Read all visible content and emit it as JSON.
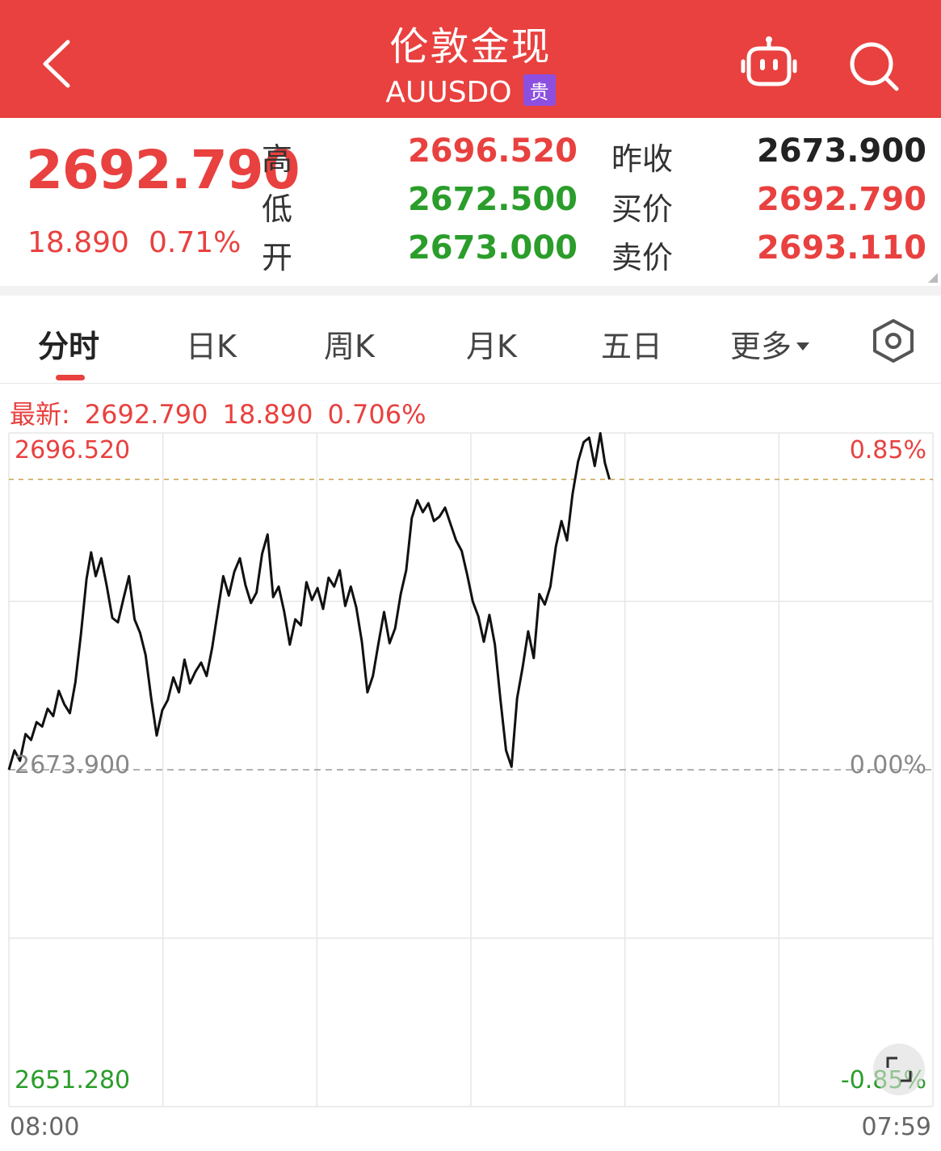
{
  "header": {
    "title": "伦敦金现",
    "code": "AUUSDO",
    "badge": "贵",
    "accent": "#e8413f"
  },
  "quote": {
    "last": "2692.790",
    "change": "18.890",
    "change_pct": "0.71%",
    "high_label": "高",
    "high": "2696.520",
    "low_label": "低",
    "low": "2672.500",
    "open_label": "开",
    "open": "2673.000",
    "prev_close_label": "昨收",
    "prev_close": "2673.900",
    "bid_label": "买价",
    "bid": "2692.790",
    "ask_label": "卖价",
    "ask": "2693.110"
  },
  "tabs": [
    {
      "label": "分时",
      "active": true
    },
    {
      "label": "日K"
    },
    {
      "label": "周K"
    },
    {
      "label": "月K"
    },
    {
      "label": "五日"
    },
    {
      "label": "更多"
    }
  ],
  "latest_line": {
    "label": "最新:",
    "price": "2692.790",
    "change": "18.890",
    "pct": "0.706%"
  },
  "chart_data": {
    "type": "line",
    "y_top_label": "2696.520",
    "y_mid_label": "2673.900",
    "y_bottom_label": "2651.280",
    "pct_top_label": "0.85%",
    "pct_mid_label": "0.00%",
    "pct_bottom_label": "-0.85%",
    "x_start_label": "08:00",
    "x_end_label": "07:59",
    "ylim": [
      2651.28,
      2696.52
    ],
    "baseline": 2673.9,
    "x_range": [
      0,
      100
    ],
    "grid": true,
    "series": [
      {
        "points": [
          [
            0,
            2673.9
          ],
          [
            0.6,
            2675.2
          ],
          [
            1.2,
            2674.5
          ],
          [
            1.8,
            2676.3
          ],
          [
            2.4,
            2675.9
          ],
          [
            3,
            2677.1
          ],
          [
            3.6,
            2676.8
          ],
          [
            4.2,
            2678.0
          ],
          [
            4.8,
            2677.5
          ],
          [
            5.4,
            2679.2
          ],
          [
            6,
            2678.3
          ],
          [
            6.6,
            2677.7
          ],
          [
            7.2,
            2679.8
          ],
          [
            7.8,
            2683.0
          ],
          [
            8.4,
            2686.7
          ],
          [
            8.9,
            2688.5
          ],
          [
            9.4,
            2686.9
          ],
          [
            10.0,
            2688.1
          ],
          [
            10.6,
            2686.2
          ],
          [
            11.2,
            2684.1
          ],
          [
            11.8,
            2683.8
          ],
          [
            12.4,
            2685.4
          ],
          [
            13.0,
            2686.9
          ],
          [
            13.6,
            2684.0
          ],
          [
            14.2,
            2683.1
          ],
          [
            14.8,
            2681.6
          ],
          [
            15.4,
            2678.7
          ],
          [
            16.0,
            2676.2
          ],
          [
            16.6,
            2677.9
          ],
          [
            17.2,
            2678.6
          ],
          [
            17.8,
            2680.1
          ],
          [
            18.4,
            2679.1
          ],
          [
            19.0,
            2681.3
          ],
          [
            19.6,
            2679.7
          ],
          [
            20.2,
            2680.5
          ],
          [
            20.8,
            2681.1
          ],
          [
            21.4,
            2680.2
          ],
          [
            22.0,
            2682.1
          ],
          [
            22.6,
            2684.5
          ],
          [
            23.2,
            2686.9
          ],
          [
            23.8,
            2685.6
          ],
          [
            24.4,
            2687.2
          ],
          [
            25.0,
            2688.1
          ],
          [
            25.6,
            2686.3
          ],
          [
            26.2,
            2685.1
          ],
          [
            26.8,
            2685.8
          ],
          [
            27.4,
            2688.4
          ],
          [
            28.0,
            2689.7
          ],
          [
            28.6,
            2685.5
          ],
          [
            29.2,
            2686.2
          ],
          [
            29.8,
            2684.5
          ],
          [
            30.4,
            2682.3
          ],
          [
            31.0,
            2684.0
          ],
          [
            31.6,
            2683.6
          ],
          [
            32.2,
            2686.5
          ],
          [
            32.8,
            2685.3
          ],
          [
            33.4,
            2686.1
          ],
          [
            34.0,
            2684.7
          ],
          [
            34.6,
            2686.8
          ],
          [
            35.2,
            2686.2
          ],
          [
            35.8,
            2687.3
          ],
          [
            36.4,
            2684.9
          ],
          [
            37.0,
            2686.2
          ],
          [
            37.6,
            2684.8
          ],
          [
            38.2,
            2682.5
          ],
          [
            38.8,
            2679.1
          ],
          [
            39.4,
            2680.2
          ],
          [
            40.0,
            2682.4
          ],
          [
            40.6,
            2684.5
          ],
          [
            41.2,
            2682.4
          ],
          [
            41.8,
            2683.4
          ],
          [
            42.4,
            2685.7
          ],
          [
            43.0,
            2687.3
          ],
          [
            43.6,
            2690.8
          ],
          [
            44.2,
            2692.0
          ],
          [
            44.8,
            2691.2
          ],
          [
            45.4,
            2691.8
          ],
          [
            46.0,
            2690.6
          ],
          [
            46.6,
            2690.9
          ],
          [
            47.2,
            2691.5
          ],
          [
            47.8,
            2690.4
          ],
          [
            48.4,
            2689.3
          ],
          [
            49.0,
            2688.6
          ],
          [
            49.6,
            2687.0
          ],
          [
            50.2,
            2685.2
          ],
          [
            50.8,
            2684.2
          ],
          [
            51.4,
            2682.5
          ],
          [
            52.0,
            2684.3
          ],
          [
            52.6,
            2682.3
          ],
          [
            53.2,
            2678.6
          ],
          [
            53.8,
            2675.2
          ],
          [
            54.4,
            2674.1
          ],
          [
            55.0,
            2678.7
          ],
          [
            55.6,
            2680.8
          ],
          [
            56.2,
            2683.2
          ],
          [
            56.8,
            2681.4
          ],
          [
            57.4,
            2685.7
          ],
          [
            58.0,
            2685.0
          ],
          [
            58.6,
            2686.2
          ],
          [
            59.2,
            2688.9
          ],
          [
            59.8,
            2690.6
          ],
          [
            60.4,
            2689.3
          ],
          [
            61.0,
            2692.4
          ],
          [
            61.6,
            2694.6
          ],
          [
            62.2,
            2695.9
          ],
          [
            62.8,
            2696.2
          ],
          [
            63.4,
            2694.3
          ],
          [
            64.0,
            2696.5
          ],
          [
            64.5,
            2694.5
          ],
          [
            65.0,
            2693.4
          ]
        ]
      }
    ]
  }
}
